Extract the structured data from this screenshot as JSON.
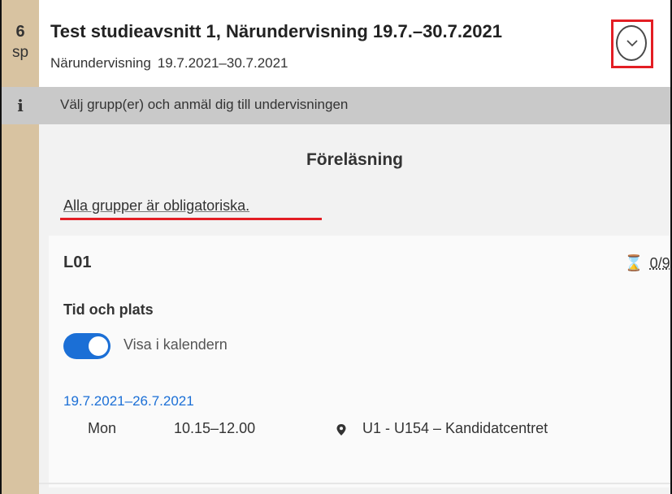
{
  "course": {
    "credits_number": "6",
    "credits_unit": "sp",
    "title": "Test studieavsnitt 1, Närundervisning 19.7.–30.7.2021",
    "subtitle_type": "Närundervisning",
    "subtitle_dates": "19.7.2021–30.7.2021",
    "expand_icon": "chevron-down-icon"
  },
  "info": {
    "icon_glyph": "i",
    "text": "Välj grupp(er) och anmäl dig till undervisningen"
  },
  "section": {
    "title": "Föreläsning",
    "mandatory_note": "Alla grupper är obligatoriska."
  },
  "group": {
    "name": "L01",
    "seats": "0/9",
    "time_place_label": "Tid och plats",
    "calendar_toggle_label": "Visa i kalendern",
    "calendar_toggle_on": true,
    "date_range": "19.7.2021–26.7.2021",
    "schedule": {
      "day": "Mon",
      "time": "10.15–12.00",
      "location": "U1 - U154 – Kandidatcentret"
    }
  },
  "colors": {
    "credits_strip": "#d8c3a1",
    "info_bar": "#c9c9c9",
    "accent_blue": "#1b6fd6",
    "highlight_red": "#e31e24"
  }
}
